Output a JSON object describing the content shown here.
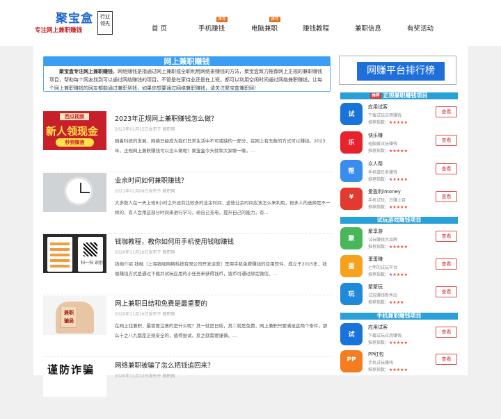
{
  "header": {
    "logo_main": "聚宝盒",
    "logo_sub": "专注网上兼职赚钱",
    "logo_seal": "行业领先",
    "nav": [
      {
        "label": "首 页",
        "hot": false
      },
      {
        "label": "手机赚钱",
        "hot": true
      },
      {
        "label": "电脑兼职",
        "hot": true
      },
      {
        "label": "赚钱教程",
        "hot": false
      },
      {
        "label": "兼职信息",
        "hot": false
      },
      {
        "label": "有奖活动",
        "hot": false
      }
    ],
    "hot_label": "推荐"
  },
  "intro": {
    "title": "网上兼职赚钱",
    "brand": "聚宝盒专注网上兼职赚钱",
    "text": "，网络赚钱是指通过网上兼职或全职利用网络来赚钱的方法，聚宝盒致力推荐网上正规的兼职赚钱项目，帮助每个网友找到可以通过网络赚钱的项目，不管是在家待业还是在上班，都可以利用空闲时间通过网络兼职赚钱，让每个网上兼职赚钱的网友都能通过兼职到钱，如果你想要通过网络兼职赚钱，请关注聚宝盒兼职网！"
  },
  "articles": [
    {
      "title": "2023年正规网上兼职赚钱怎么做？",
      "meta": "2023年01月15日发布于 兼职网",
      "text": "随着科技的发展，网络已经成为我们日常生活中不可或缺的一部分，在网上有无数的方式可以赚钱。2023年，正规网上兼职赚钱可以怎么做呢？聚宝盒今天就和大家聊一聊。...",
      "thumb": {
        "badge": "西瓜视频",
        "big": "新人领现金",
        "btn": "秒到微信"
      }
    },
    {
      "title": "业余时间如何兼职赚钱？",
      "meta": "2021年01月08日发布于 兼职网",
      "text": "大多数人在一天上班8小时之外还有比较多的业余时间，这些业余时间应该怎么来利用，很多人的选择是不一样的，有人会用这部分时间来进行学习，给自己充电，提升自己的能力，有...",
      "thumb": {}
    },
    {
      "title": "钱咖教程，教你如何用手机使用钱咖赚钱",
      "meta": "2020年11月26日发布于 兼职网",
      "text": "钱咖介绍 钱咖（上海钱咖网络科技有限公司开发运营）是用手机免费赚钱的应用软件，成立于2015年，钱咖赚钱方式是通过下载并试玩应用的小任务来获得钱币，钱币可通过绑定微信、...",
      "thumb": {
        "qr_text": "扫一扫 识别"
      }
    },
    {
      "title": "网上兼职日结和免费是最重要的",
      "meta": "2020年11月16日发布于 兼职网",
      "text": "在网上找兼职，最需要注意的是什么呢？其一就是日结，其二就是免费，网上兼职只要满足这两个条件，那么十之八九都是正规安全的，值得尝试，反之就需要谨慎。...",
      "thumb": {
        "card": "兼职 骗局"
      }
    },
    {
      "title": "网络兼职被骗了怎么把钱追回来？",
      "meta": "2020年11月12日发布于 兼职网",
      "text": "",
      "thumb": {
        "big": "谨防诈骗"
      }
    }
  ],
  "sidebar": {
    "banner": "网赚平台排行榜",
    "sections": [
      {
        "title": "正规兼职赚钱项目",
        "tag": "推荐",
        "apps": [
          {
            "name": "应用试客",
            "desc": "下载试玩应用赚钱",
            "stars": "★★★★★",
            "icon_text": "试"
          },
          {
            "name": "快乐赚",
            "desc": "电脑做试玩赚钱",
            "stars": "★★★★★",
            "icon_text": "乐"
          },
          {
            "name": "众人帮",
            "desc": "手机做任务赚钱",
            "stars": "★★★★★",
            "icon_text": "帮"
          },
          {
            "name": "爱盈利imoney",
            "desc": "手机试玩，日赚上百",
            "stars": "★★★★★",
            "icon_text": "¥"
          }
        ]
      },
      {
        "title": "试玩游戏赚钱项目",
        "tag": "",
        "apps": [
          {
            "name": "聚享游",
            "desc": "试玩赚钱大品牌",
            "stars": "★★★★★",
            "icon_text": "聚"
          },
          {
            "name": "蛋蛋赚",
            "desc": "七年的试玩平台",
            "stars": "★★★★★",
            "icon_text": "蛋"
          },
          {
            "name": "聚聚玩",
            "desc": "试玩赚钱新秀站",
            "stars": "★★★★",
            "icon_text": "玩"
          }
        ]
      },
      {
        "title": "手机兼职赚钱项目",
        "tag": "",
        "apps": [
          {
            "name": "应用试客",
            "desc": "下载试玩应用赚钱",
            "stars": "★★★★★",
            "icon_text": "试"
          },
          {
            "name": "PP红包",
            "desc": "手机试玩赚钱",
            "stars": "★★★★★",
            "icon_text": "PP"
          }
        ]
      }
    ],
    "stars_label": "推荐指数：",
    "button_label": "查看"
  }
}
